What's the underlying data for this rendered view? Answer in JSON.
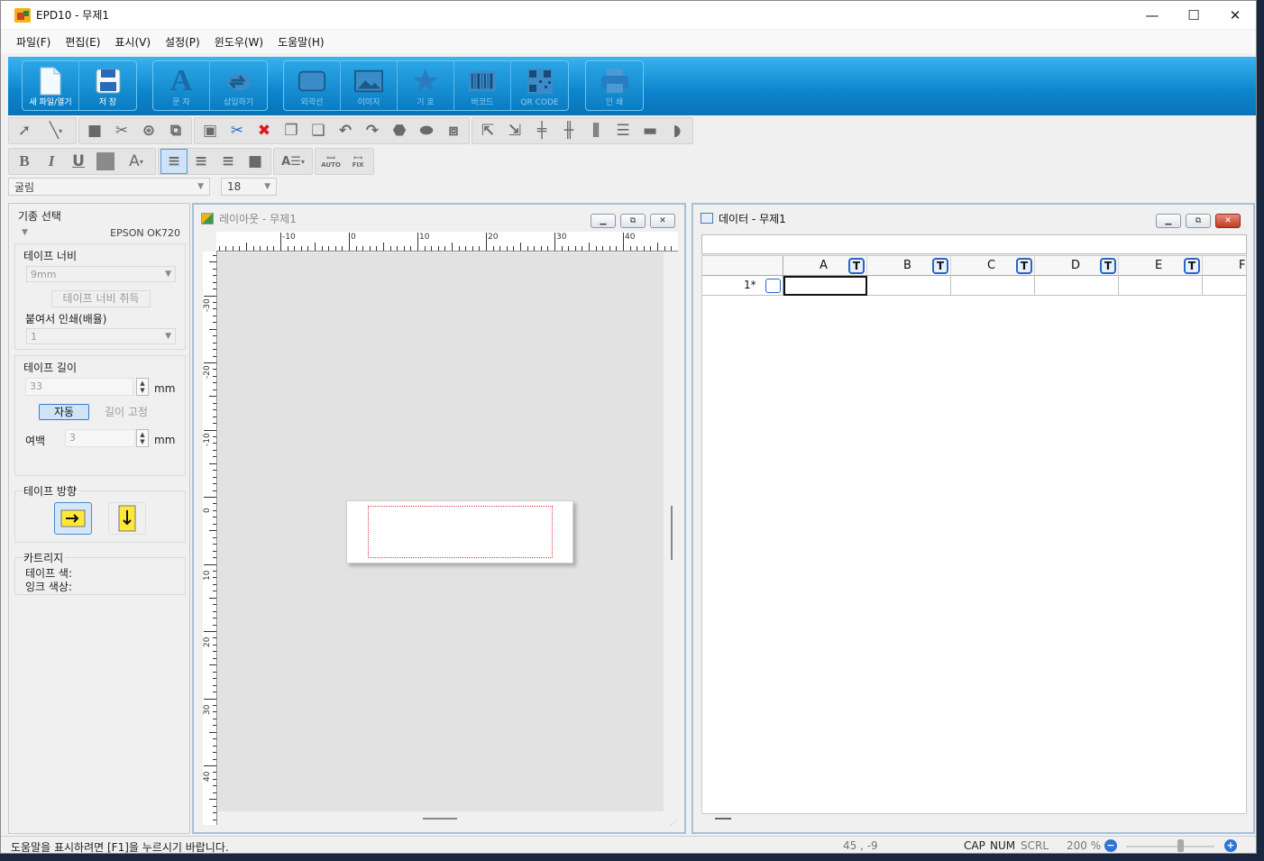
{
  "window": {
    "title": "EPD10 - 무제1",
    "minimize": "—",
    "maximize": "☐",
    "close": "✕"
  },
  "menu": [
    "파일(F)",
    "편집(E)",
    "표시(V)",
    "설정(P)",
    "윈도우(W)",
    "도움말(H)"
  ],
  "ribbon": {
    "new_open": "새 파일/열기",
    "save": "저 장",
    "text": "문 자",
    "insert": "삽입하기",
    "frame": "외곽선",
    "image": "이미지",
    "symbol": "기 호",
    "barcode": "바코드",
    "qrcode": "QR CODE",
    "print": "인 쇄"
  },
  "format": {
    "bold": "B",
    "italic": "I",
    "underline": "U",
    "font_color": "A",
    "auto": "AUTO",
    "fix": "FIX"
  },
  "font": {
    "family": "굴림",
    "size": "18"
  },
  "left_panel": {
    "model_label": "기종 선택",
    "model_value": "EPSON OK720",
    "tape_width_label": "테이프 너비",
    "tape_width_value": "9mm",
    "get_tape_width": "테이프 너비 취득",
    "multi_print_label": "붙여서 인쇄(배율)",
    "multi_print_value": "1",
    "tape_length_label": "테이프 길이",
    "tape_length_value": "33",
    "unit_mm": "mm",
    "auto_button": "자동",
    "fixed_length": "길이 고정",
    "margin_label": "여백",
    "margin_value": "3",
    "direction_label": "테이프 방향",
    "cartridge_label": "카트리지",
    "tape_color_label": "테이프 색:",
    "ink_color_label": "잉크 색상:"
  },
  "layout_window": {
    "title": "레이아웃  - 무제1",
    "h_ticks": [
      "-10",
      "0",
      "10",
      "20",
      "30",
      "40"
    ],
    "v_ticks": [
      "-30",
      "-20",
      "-10",
      "0",
      "10",
      "20",
      "30",
      "40"
    ]
  },
  "data_window": {
    "title": "데이터  - 무제1",
    "columns": [
      "A",
      "B",
      "C",
      "D",
      "E",
      "F"
    ],
    "text_badge": "T",
    "row_label": "1*"
  },
  "status": {
    "help": "도움말을 표시하려면 [F1]을 누르시기 바랍니다.",
    "coords": "45 , -9",
    "cap": "CAP",
    "num": "NUM",
    "scrl": "SCRL",
    "zoom": "200 %",
    "zoom_out": "−",
    "zoom_in": "+"
  },
  "colors": {
    "ribbon_blue": "#0c84cc",
    "accent_blue": "#2a64c8",
    "tape_guide_red": "#e04040"
  }
}
